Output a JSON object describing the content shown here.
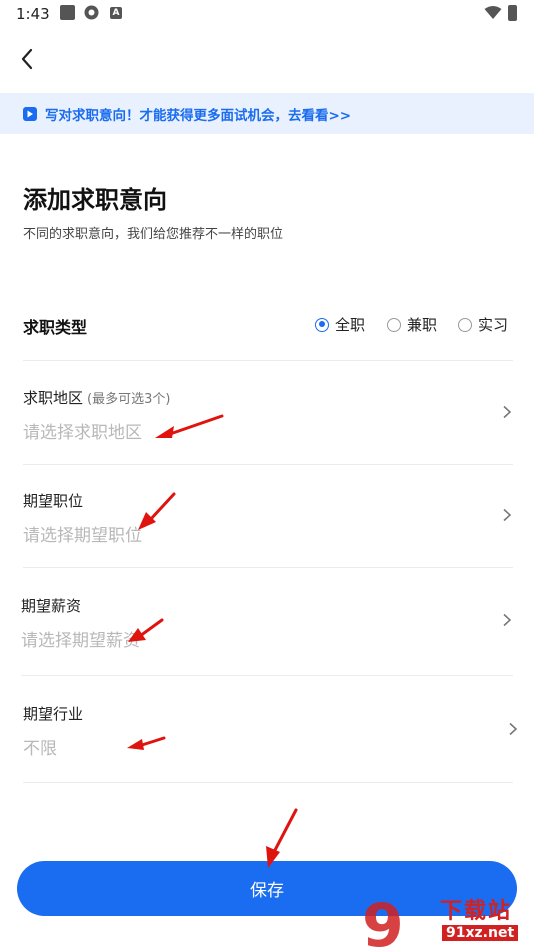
{
  "status_bar": {
    "time": "1:43"
  },
  "promo": {
    "text": "写对求职意向！才能获得更多面试机会，去看看>>"
  },
  "page": {
    "title": "添加求职意向",
    "subtitle": "不同的求职意向，我们给您推荐不一样的职位"
  },
  "job_type": {
    "label": "求职类型",
    "options": [
      {
        "label": "全职",
        "selected": true
      },
      {
        "label": "兼职",
        "selected": false
      },
      {
        "label": "实习",
        "selected": false
      }
    ]
  },
  "fields": {
    "region": {
      "label": "求职地区",
      "hint": "(最多可选3个)",
      "value": "请选择求职地区"
    },
    "position": {
      "label": "期望职位",
      "value": "请选择期望职位"
    },
    "salary": {
      "label": "期望薪资",
      "value": "请选择期望薪资"
    },
    "industry": {
      "label": "期望行业",
      "value": "不限"
    }
  },
  "save_label": "保存",
  "watermark": {
    "line1": "下载站",
    "line2": "91xz.net"
  },
  "colors": {
    "accent": "#1a6cf0",
    "annotation_arrow": "#e0140f"
  }
}
